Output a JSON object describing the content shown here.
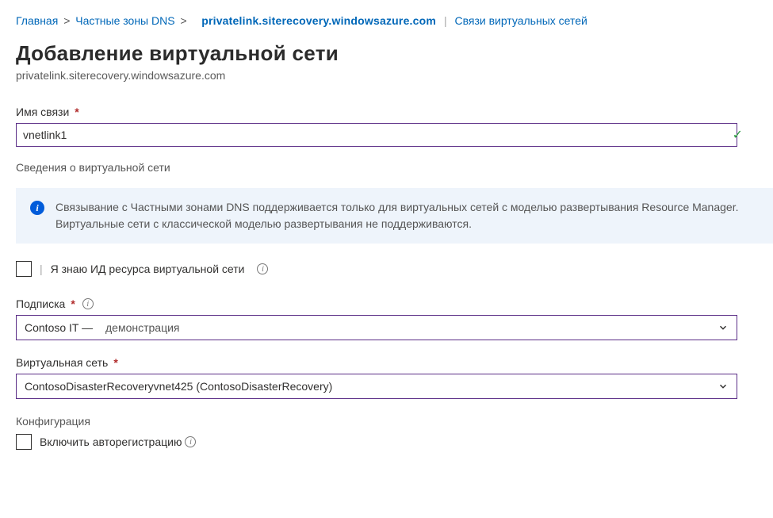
{
  "breadcrumb": {
    "home": "Главная",
    "zones": "Частные зоны DNS",
    "zone_name": "privatelink.siterecovery.windowsazure.com",
    "links": "Связи виртуальных сетей"
  },
  "page": {
    "title": "Добавление виртуальной сети",
    "subtitle": "privatelink.siterecovery.windowsazure.com"
  },
  "fields": {
    "link_name_label": "Имя связи",
    "link_name_value": "vnetlink1",
    "vnet_section": "Сведения о виртуальной сети",
    "info_message": "Связывание с Частными зонами DNS поддерживается только для виртуальных сетей с моделью развертывания Resource Manager. Виртуальные сети с классической моделью развертывания не поддерживаются.",
    "know_id_label": "Я знаю ИД ресурса виртуальной сети",
    "subscription_label": "Подписка",
    "subscription_value_main": "Contoso IT —",
    "subscription_value_sub": "демонстрация",
    "vnet_label": "Виртуальная сеть",
    "vnet_value": "ContosoDisasterRecoveryvnet425 (ContosoDisasterRecovery)",
    "config_label": "Конфигурация",
    "autoreg_label": "Включить авторегистрацию"
  }
}
